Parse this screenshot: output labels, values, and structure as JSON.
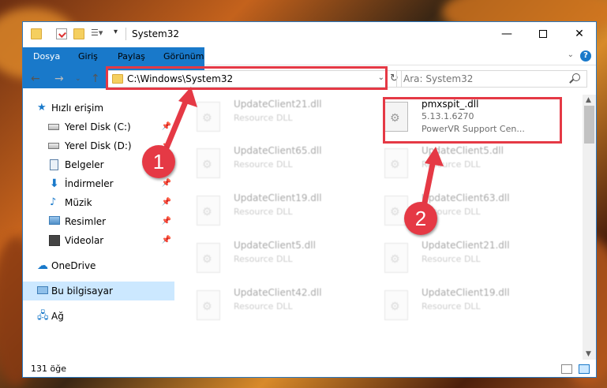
{
  "titlebar": {
    "title": "System32",
    "minimize_icon": "minimize-icon",
    "maximize_icon": "maximize-icon",
    "close_icon": "close-icon"
  },
  "ribbon": {
    "tabs": [
      "Dosya",
      "Giriş",
      "Paylaş",
      "Görünüm"
    ]
  },
  "navigation": {
    "address_path": "C:\\Windows\\System32",
    "search_placeholder": "Ara: System32"
  },
  "sidebar": {
    "items": [
      {
        "label": "Hızlı erişim",
        "icon": "star-icon"
      },
      {
        "label": "Yerel Disk (C:)",
        "icon": "drive-icon",
        "pinned": true
      },
      {
        "label": "Yerel Disk (D:)",
        "icon": "drive-icon",
        "pinned": true
      },
      {
        "label": "Belgeler",
        "icon": "documents-icon",
        "pinned": true
      },
      {
        "label": "İndirmeler",
        "icon": "downloads-icon",
        "pinned": true
      },
      {
        "label": "Müzik",
        "icon": "music-icon",
        "pinned": true
      },
      {
        "label": "Resimler",
        "icon": "pictures-icon",
        "pinned": true
      },
      {
        "label": "Videolar",
        "icon": "videos-icon",
        "pinned": true
      },
      {
        "label": "OneDrive",
        "icon": "onedrive-icon"
      },
      {
        "label": "Bu bilgisayar",
        "icon": "computer-icon",
        "selected": true
      },
      {
        "label": "Ağ",
        "icon": "network-icon"
      }
    ]
  },
  "files": [
    {
      "name": "UpdateClient21.dll",
      "type": "Resource DLL"
    },
    {
      "name": "pmxspit_.dll",
      "version": "5.13.1.6270",
      "description": "PowerVR Support Cen...",
      "highlighted": true
    },
    {
      "name": "UpdateClient65.dll",
      "type": "Resource DLL"
    },
    {
      "name": "UpdateClient5.dll",
      "type": "Resource DLL"
    },
    {
      "name": "UpdateClient19.dll",
      "type": "Resource DLL"
    },
    {
      "name": "UpdateClient63.dll",
      "type": "Resource DLL"
    },
    {
      "name": "UpdateClient5.dll",
      "type": "Resource DLL"
    },
    {
      "name": "UpdateClient21.dll",
      "type": "Resource DLL"
    },
    {
      "name": "UpdateClient42.dll",
      "type": "Resource DLL"
    },
    {
      "name": "UpdateClient19.dll",
      "type": "Resource DLL"
    }
  ],
  "statusbar": {
    "item_count": "131 öğe"
  },
  "annotations": {
    "marker1": "1",
    "marker2": "2",
    "color": "#e53945"
  }
}
